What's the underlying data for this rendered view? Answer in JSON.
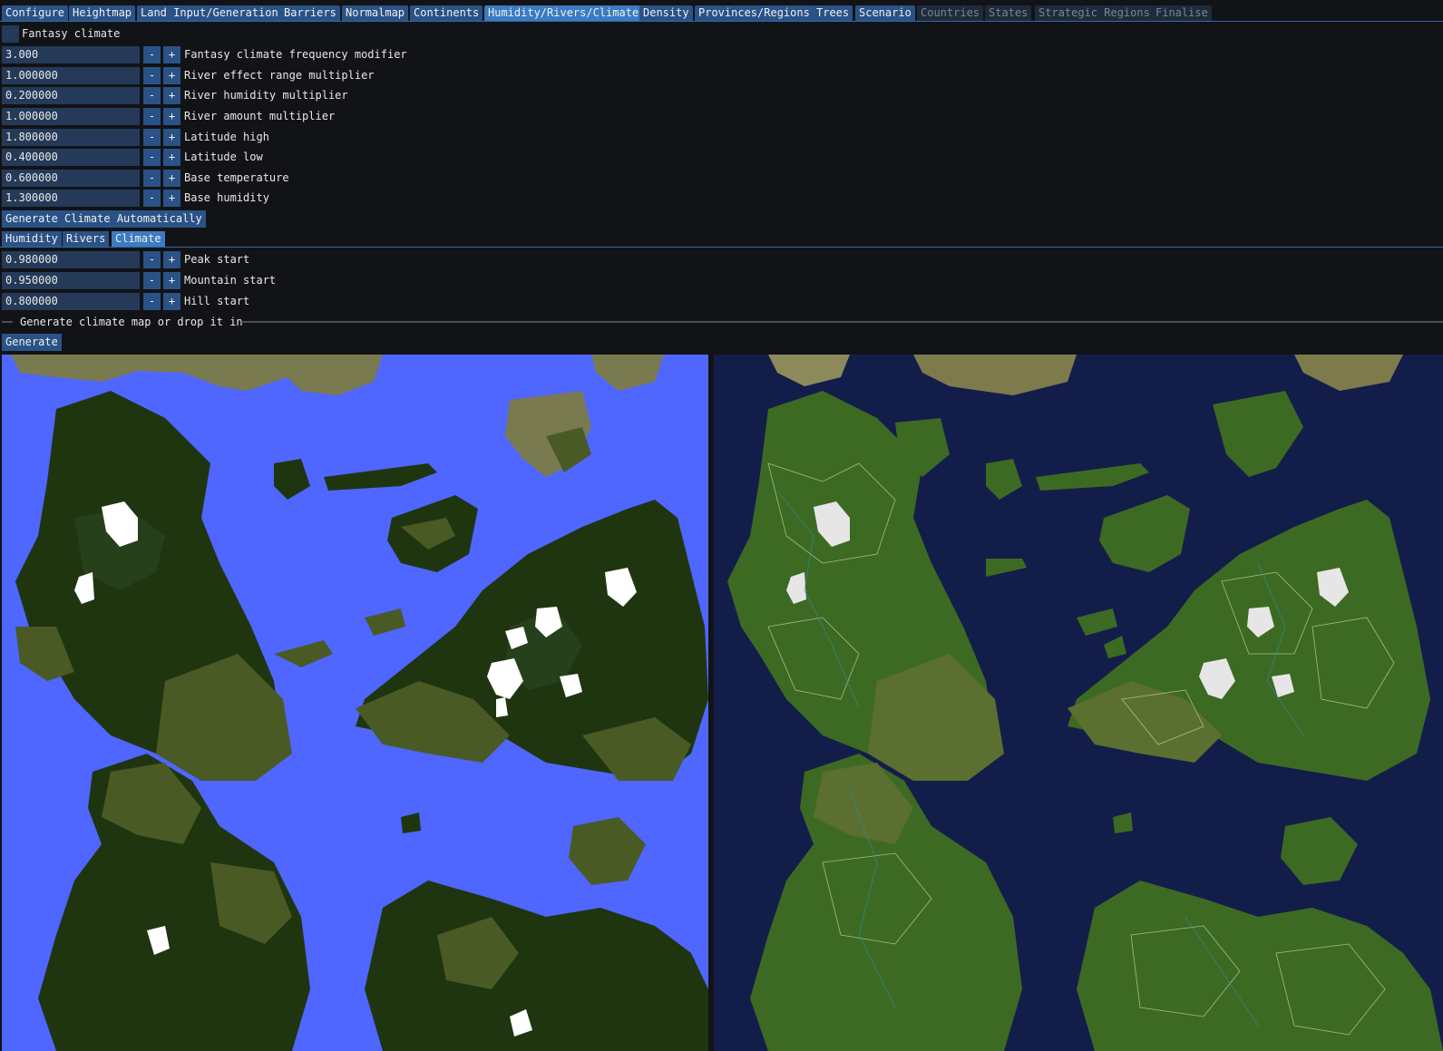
{
  "tabs": [
    {
      "label": "Configure",
      "state": "enabled"
    },
    {
      "label": "Heightmap",
      "state": "enabled"
    },
    {
      "label": "Land Input/Generation",
      "state": "enabled"
    },
    {
      "label": "Barriers",
      "state": "enabled"
    },
    {
      "label": "Normalmap",
      "state": "enabled"
    },
    {
      "label": "Continents",
      "state": "enabled"
    },
    {
      "label": "Humidity/Rivers/Climate",
      "state": "active"
    },
    {
      "label": "Density",
      "state": "enabled"
    },
    {
      "label": "Provinces/Regions",
      "state": "enabled"
    },
    {
      "label": "Trees",
      "state": "enabled"
    },
    {
      "label": "Scenario",
      "state": "enabled"
    },
    {
      "label": "Countries",
      "state": "disabled"
    },
    {
      "label": "States",
      "state": "disabled"
    },
    {
      "label": "Strategic Regions",
      "state": "disabled"
    },
    {
      "label": "Finalise",
      "state": "disabled"
    }
  ],
  "fantasy_climate": {
    "label": "Fantasy climate",
    "checked": false
  },
  "params": [
    {
      "value": "3.000",
      "label": "Fantasy climate frequency modifier"
    },
    {
      "value": "1.000000",
      "label": "River effect range multiplier"
    },
    {
      "value": "0.200000",
      "label": "River humidity multiplier"
    },
    {
      "value": "1.000000",
      "label": "River amount multiplier"
    },
    {
      "value": "1.800000",
      "label": "Latitude high"
    },
    {
      "value": "0.400000",
      "label": "Latitude low"
    },
    {
      "value": "0.600000",
      "label": "Base temperature"
    },
    {
      "value": "1.300000",
      "label": "Base humidity"
    }
  ],
  "stepper": {
    "minus": "-",
    "plus": "+"
  },
  "generate_auto_label": "Generate Climate Automatically",
  "subtabs": [
    {
      "label": "Humidity",
      "active": false
    },
    {
      "label": "Rivers",
      "active": false
    },
    {
      "label": "Climate",
      "active": true
    }
  ],
  "climate_params": [
    {
      "value": "0.980000",
      "label": "Peak start"
    },
    {
      "value": "0.950000",
      "label": "Mountain start"
    },
    {
      "value": "0.800000",
      "label": "Hill start"
    }
  ],
  "separator_text": "Generate climate map or drop it in",
  "generate_label": "Generate",
  "colors": {
    "background": "#121316",
    "tab": "#2a5286",
    "tab_active": "#3b7bc2",
    "tab_disabled": "#1e2b3c",
    "field": "#243a58",
    "climate_water": "#4f66ff",
    "climate_forest": "#1f3510",
    "climate_grass": "#4a5a25",
    "climate_arid": "#7a7a50",
    "climate_snow": "#ffffff",
    "terrain_sea": "#131d4a",
    "terrain_land": "#3d6a22"
  }
}
